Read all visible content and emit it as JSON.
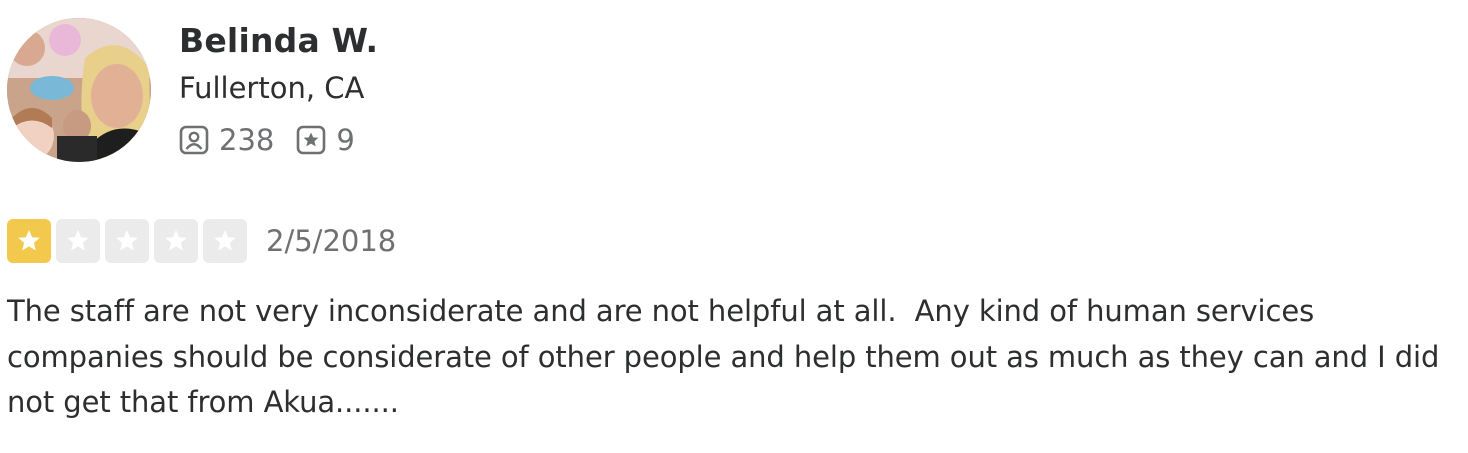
{
  "reviewer": {
    "name": "Belinda W.",
    "location": "Fullerton, CA",
    "friends_count": "238",
    "reviews_count": "9"
  },
  "review": {
    "rating": 1,
    "max_rating": 5,
    "date": "2/5/2018",
    "text": "The staff are not very inconsiderate and are not helpful at all.  Any kind of human services companies should be considerate of other people and help them out as much as they can and I did not get that from Akua......."
  },
  "colors": {
    "star_filled": "#f2c94c",
    "star_empty": "#ebebeb",
    "text": "#2d2e2f",
    "muted": "#6e7072"
  },
  "icons": {
    "friends": "friends-icon",
    "reviews": "review-star-icon",
    "star": "star-icon"
  }
}
